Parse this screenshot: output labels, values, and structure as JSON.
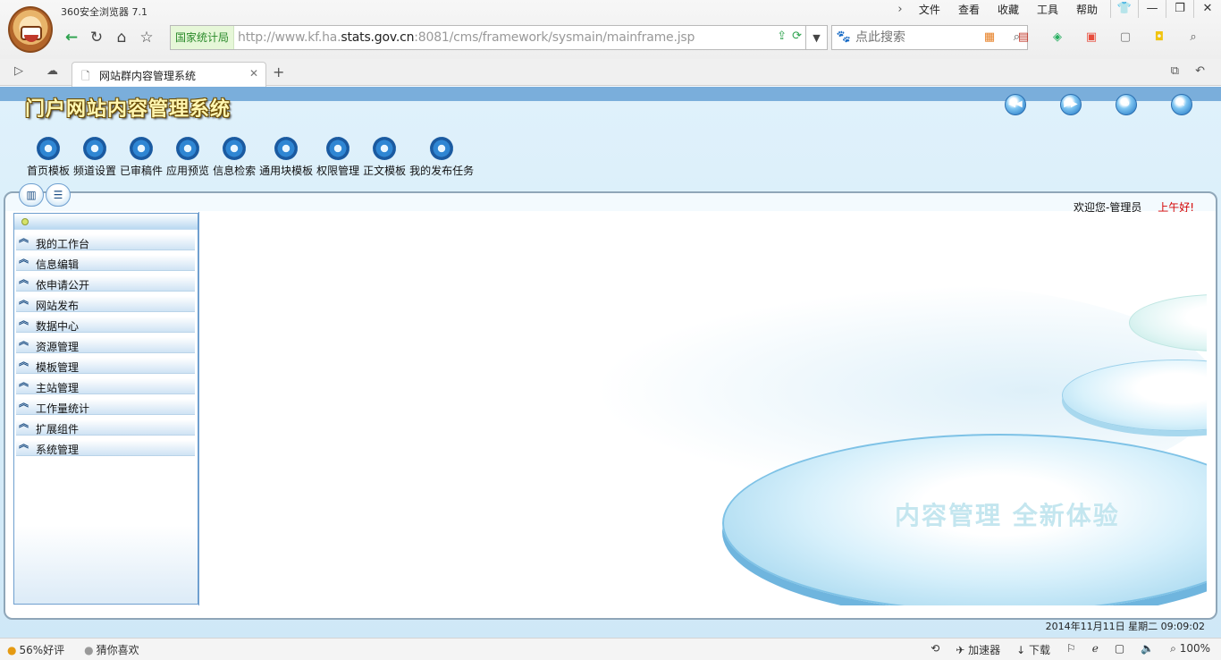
{
  "browser": {
    "app_name": "360安全浏览器 7.1",
    "menu": [
      "文件",
      "查看",
      "收藏",
      "工具",
      "帮助"
    ],
    "site_badge": "国家统计局",
    "url_prefix": "http://www.kf.ha.",
    "url_domain": "stats.gov.cn",
    "url_suffix": ":8081/cms/framework/sysmain/mainframe.jsp",
    "search_placeholder": "点此搜索",
    "tab_title": "网站群内容管理系统"
  },
  "cms": {
    "title": "门户网站内容管理系统",
    "toolbar": [
      "首页模板",
      "频道设置",
      "已审稿件",
      "应用预览",
      "信息检索",
      "通用块模板",
      "权限管理",
      "正文模板",
      "我的发布任务"
    ],
    "welcome_user": "欢迎您-管理员",
    "greeting": "上午好!",
    "sidebar_items": [
      "我的工作台",
      "信息编辑",
      "依申请公开",
      "网站发布",
      "数据中心",
      "资源管理",
      "模板管理",
      "主站管理",
      "工作量统计",
      "扩展组件",
      "系统管理"
    ],
    "slogan": "内容管理  全新体验",
    "datetime": "2014年11月11日  星期二  09:09:02"
  },
  "statusbar": {
    "rating": "56%好评",
    "guess": "猜你喜欢",
    "accelerator": "加速器",
    "download": "下载",
    "zoom": "100%"
  },
  "colors": {
    "header_band": "#7aaedb",
    "title_text": "#fff6b0",
    "greeting": "#d40000",
    "site_badge_text": "#2a8a2a"
  }
}
